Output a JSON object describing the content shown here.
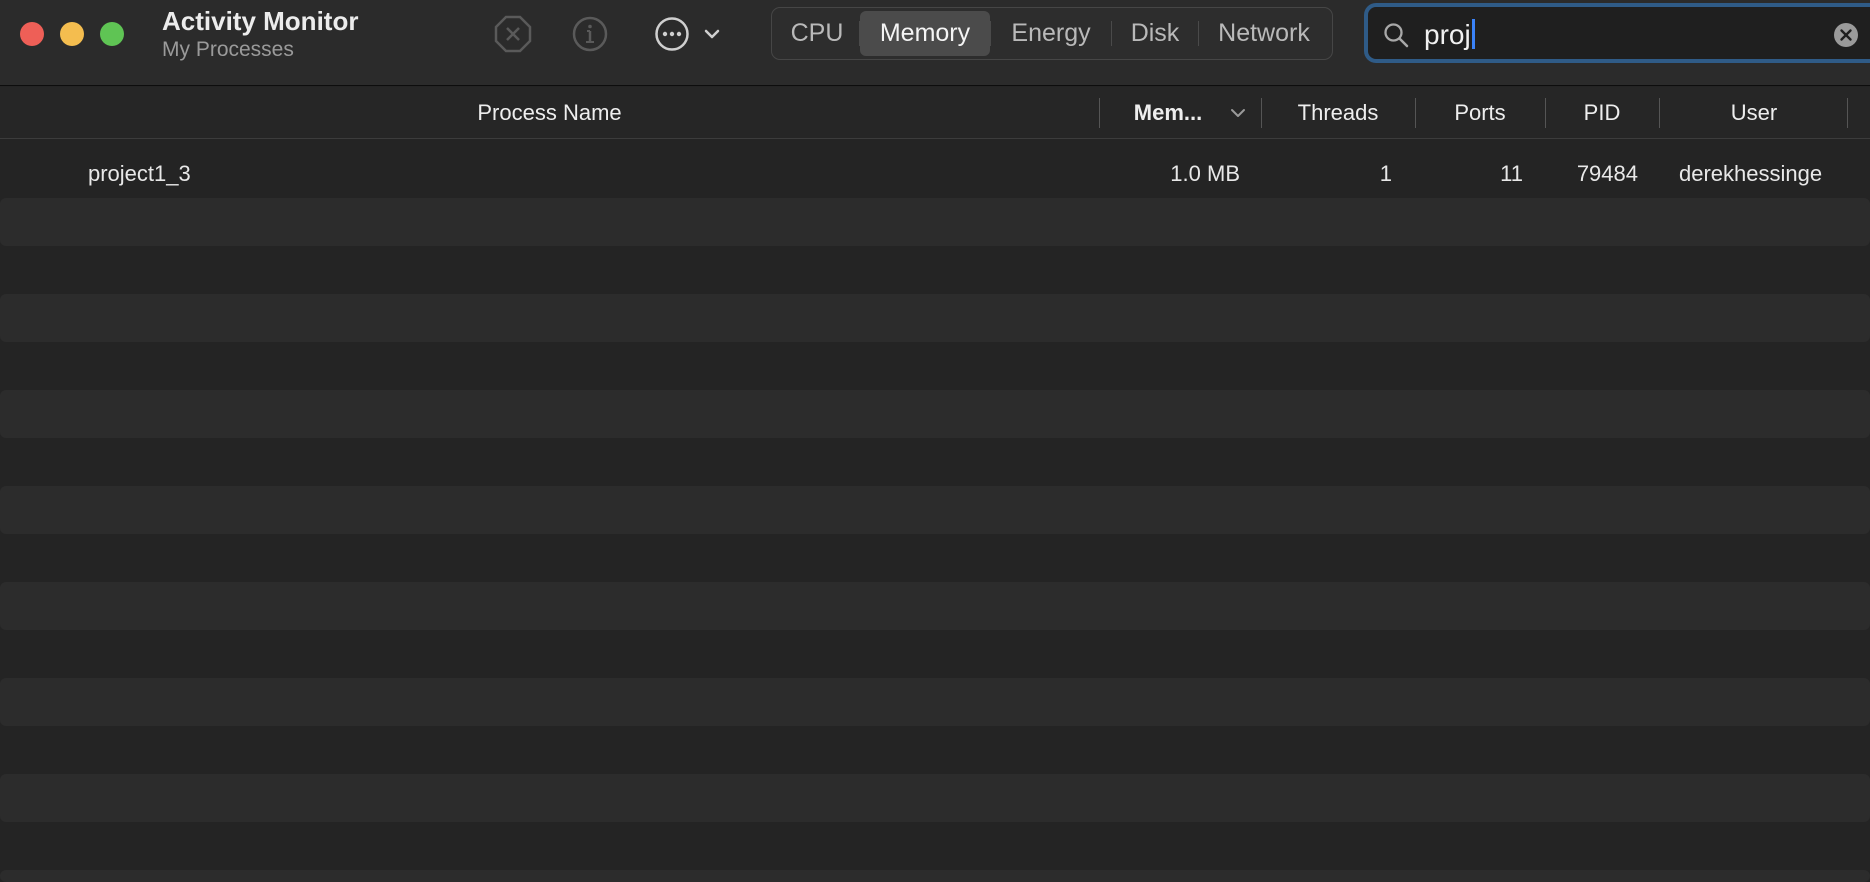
{
  "window": {
    "title": "Activity Monitor",
    "subtitle": "My Processes"
  },
  "toolbar": {
    "icons": [
      "stop-process-icon",
      "info-icon",
      "more-actions-icon",
      "chevron-down-icon"
    ],
    "tabs": [
      {
        "label": "CPU",
        "active": false
      },
      {
        "label": "Memory",
        "active": true
      },
      {
        "label": "Energy",
        "active": false
      },
      {
        "label": "Disk",
        "active": false
      },
      {
        "label": "Network",
        "active": false
      }
    ]
  },
  "search": {
    "value": "proj",
    "accent_color": "#2f5b87",
    "caret_color": "#3a82f7"
  },
  "table": {
    "columns": [
      "Process Name",
      "Mem...",
      "Threads",
      "Ports",
      "PID",
      "User"
    ],
    "sorted_column": "Mem...",
    "rows": [
      {
        "name": "project1_3",
        "memory": "1.0 MB",
        "threads": "1",
        "ports": "11",
        "pid": "79484",
        "user": "derekhessinge"
      }
    ]
  },
  "colors": {
    "close": "#ee5f57",
    "minimize": "#f4bd4f",
    "zoom": "#5fc454",
    "background": "#242424",
    "stripe": "#2c2c2c"
  }
}
